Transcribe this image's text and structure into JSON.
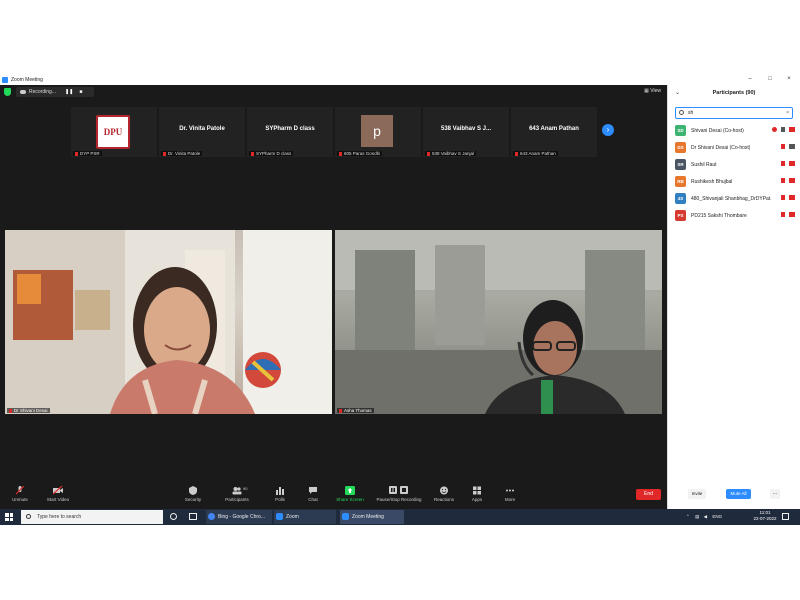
{
  "window": {
    "title": "Zoom Meeting",
    "controls": [
      "–",
      "□",
      "×"
    ]
  },
  "topbar": {
    "recording_label": "Recording...",
    "pause_symbol": "❚❚",
    "stop_symbol": "■",
    "view_label": "View"
  },
  "strip": {
    "tiles": [
      {
        "big": "",
        "name": "DYP PSR",
        "kind": "logo",
        "logo_text": "DPU"
      },
      {
        "big": "Dr. Vinita Patole",
        "name": "Dr. Vinita Patole"
      },
      {
        "big": "SYPharm D class",
        "name": "SYPharm D class"
      },
      {
        "big": "",
        "name": "605 Paras Gondhi",
        "kind": "avatar",
        "avatar_letter": "p"
      },
      {
        "big": "538 Vaibhav S J...",
        "name": "538 Vaibhav S Janjal"
      },
      {
        "big": "643 Anam Pathan",
        "name": "643 Anam Pathan"
      }
    ],
    "next_symbol": "›"
  },
  "videos": {
    "left_name": "Dr Shivani Desai",
    "right_name": "Asha Thomas"
  },
  "toolbar": {
    "unmute": "Unmute",
    "start_video": "Start Video",
    "security": "Security",
    "participants": "Participants",
    "participants_count": "90",
    "polls": "Polls",
    "chat": "Chat",
    "share_screen": "Share Screen",
    "pause_stop_recording": "Pause/Stop Recording",
    "reactions": "Reactions",
    "apps": "Apps",
    "more": "More",
    "end": "End"
  },
  "panel": {
    "title": "Participants (90)",
    "search_value": "sh",
    "clear_symbol": "×",
    "participants": [
      {
        "initials": "SD",
        "name": "Shivani Desai (Co-host)",
        "color": "#3cb371"
      },
      {
        "initials": "DS",
        "name": "Dr Shivani Desai (Co-host)",
        "color": "#e8772e"
      },
      {
        "initials": "SR",
        "name": "Sushil Raut",
        "color": "#4a5563"
      },
      {
        "initials": "RB",
        "name": "Rushikesh Bhujbal",
        "color": "#e8772e"
      },
      {
        "initials": "4S",
        "name": "480_Shivanjali Shanbhag_DrDYPat...",
        "color": "#2f7fc1"
      },
      {
        "initials": "PS",
        "name": "PD215 Sakshi Thombare",
        "color": "#d63a2e"
      }
    ],
    "invite": "Invite",
    "mute_all": "Mute All",
    "more": "..."
  },
  "taskbar": {
    "search_placeholder": "Type here to search",
    "apps": [
      {
        "label": "Bing - Google Chro...",
        "color": "#4285f4"
      },
      {
        "label": "Zoom",
        "color": "#2d8cff"
      },
      {
        "label": "Zoom Meeting",
        "color": "#2d8cff"
      }
    ],
    "lang": "ENG",
    "time": "11:01",
    "date": "22-07-2022"
  }
}
